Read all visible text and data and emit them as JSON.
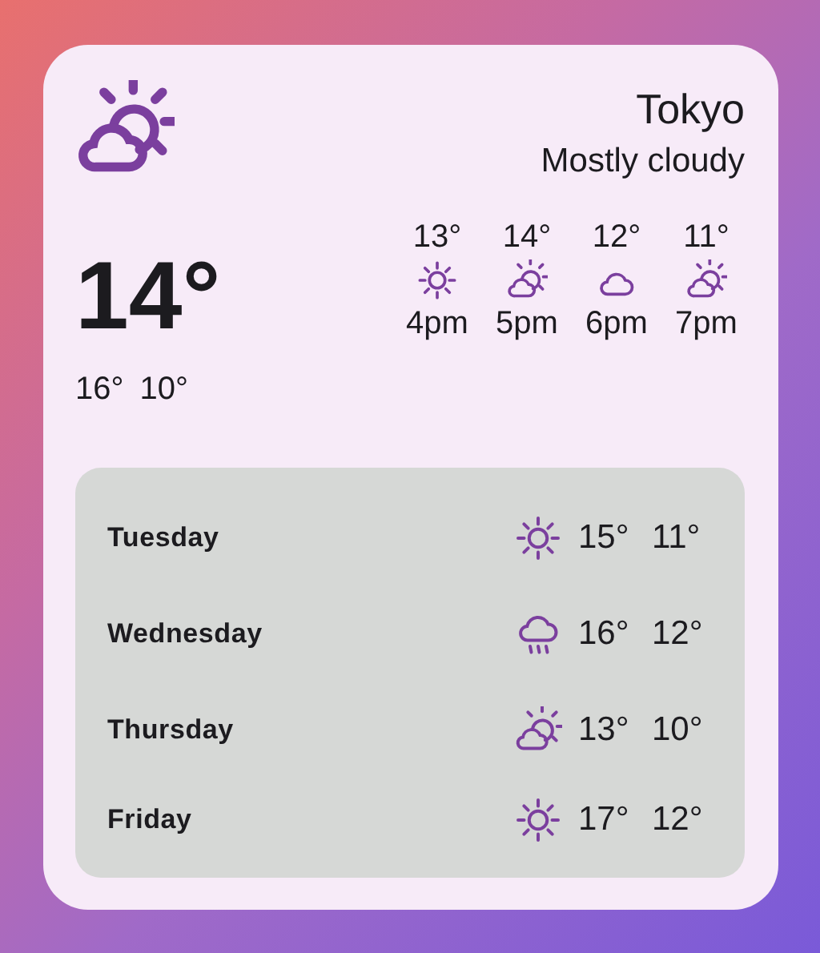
{
  "current": {
    "condition_icon": {
      "kind": "partly_cloudy"
    },
    "city": "Tokyo",
    "condition": "Mostly cloudy",
    "temperature": "14°",
    "high": "16°",
    "low": "10°"
  },
  "hourly": [
    {
      "temp": "13°",
      "kind": "sunny",
      "time": "4pm"
    },
    {
      "temp": "14°",
      "kind": "partly_cloudy",
      "time": "5pm"
    },
    {
      "temp": "12°",
      "kind": "cloudy",
      "time": "6pm"
    },
    {
      "temp": "11°",
      "kind": "partly_cloudy",
      "time": "7pm"
    }
  ],
  "daily": [
    {
      "day": "Tuesday",
      "kind": "sunny",
      "high": "15°",
      "low": "11°"
    },
    {
      "day": "Wednesday",
      "kind": "rain",
      "high": "16°",
      "low": "12°"
    },
    {
      "day": "Thursday",
      "kind": "partly_cloudy",
      "high": "13°",
      "low": "10°"
    },
    {
      "day": "Friday",
      "kind": "sunny",
      "high": "17°",
      "low": "12°"
    }
  ]
}
